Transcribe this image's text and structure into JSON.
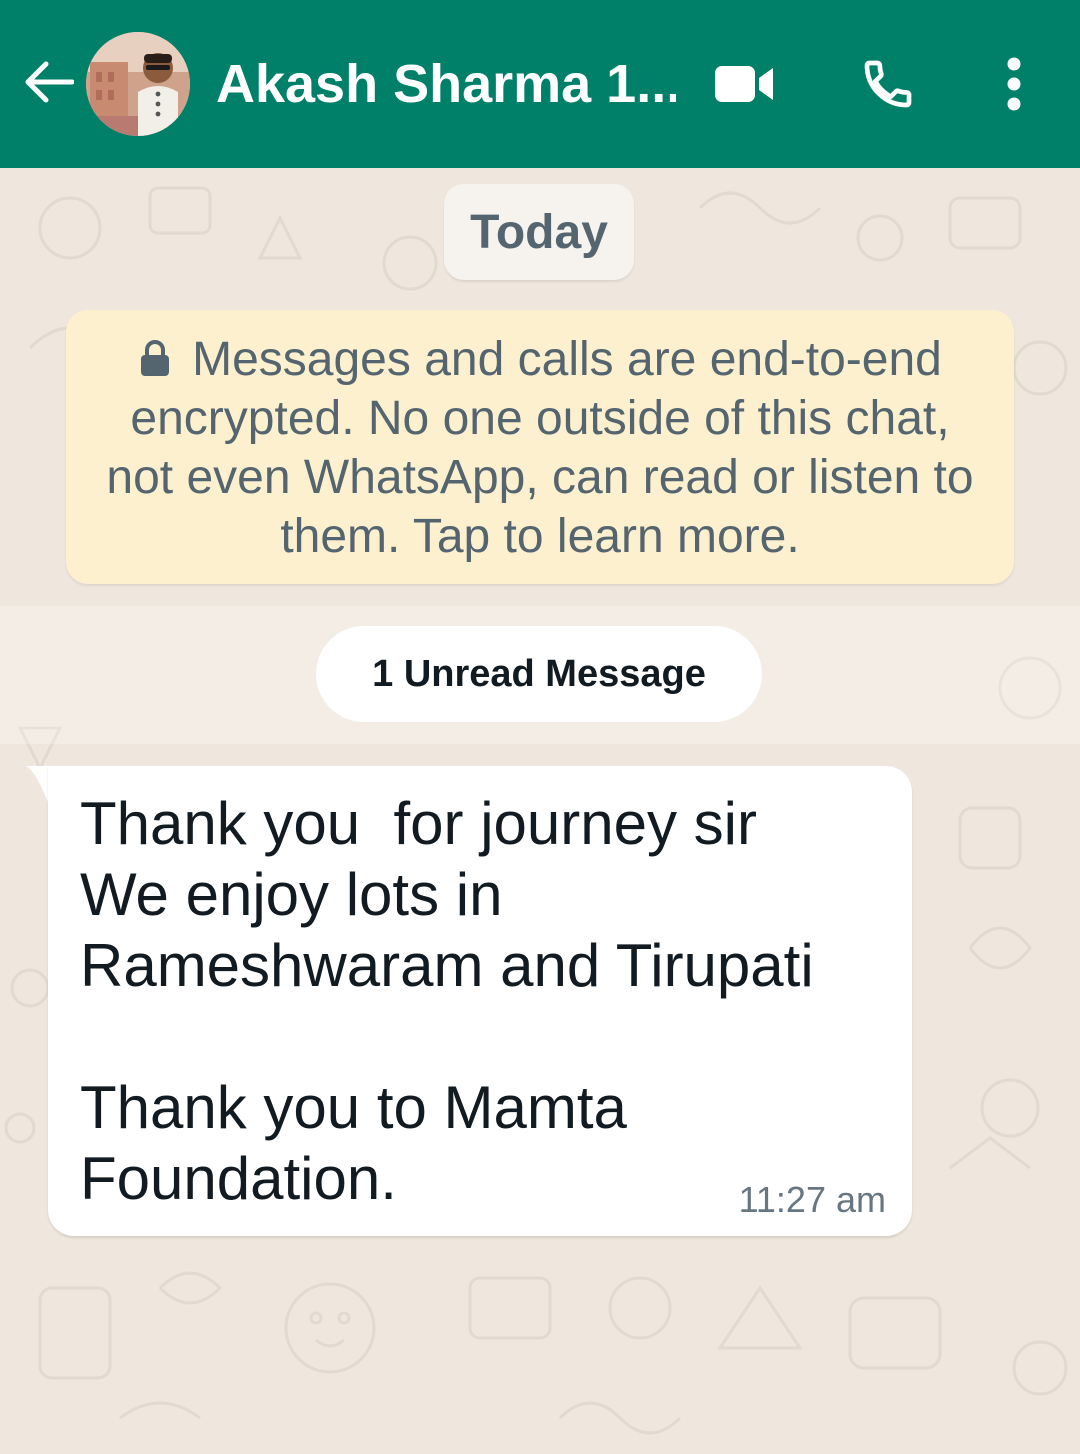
{
  "header": {
    "contact_name": "Akash Sharma 1...",
    "back_icon": "arrow-left-icon",
    "video_icon": "video-camera-icon",
    "call_icon": "phone-icon",
    "menu_icon": "more-vertical-icon",
    "background_color": "#008069"
  },
  "chat": {
    "date_label": "Today",
    "encryption_notice": "Messages and calls are end-to-end encrypted. No one outside of this chat, not even WhatsApp, can read or listen to them. Tap to learn more.",
    "unread_label": "1 Unread Message",
    "messages": [
      {
        "direction": "incoming",
        "text": "Thank you  for journey sir\nWe enjoy lots in\nRameshwaram and Tirupati\n\nThank you to Mamta\nFoundation.",
        "time": "11:27 am"
      }
    ],
    "notice_color": "#fdf0cf",
    "wallpaper_color": "#efe7de"
  }
}
